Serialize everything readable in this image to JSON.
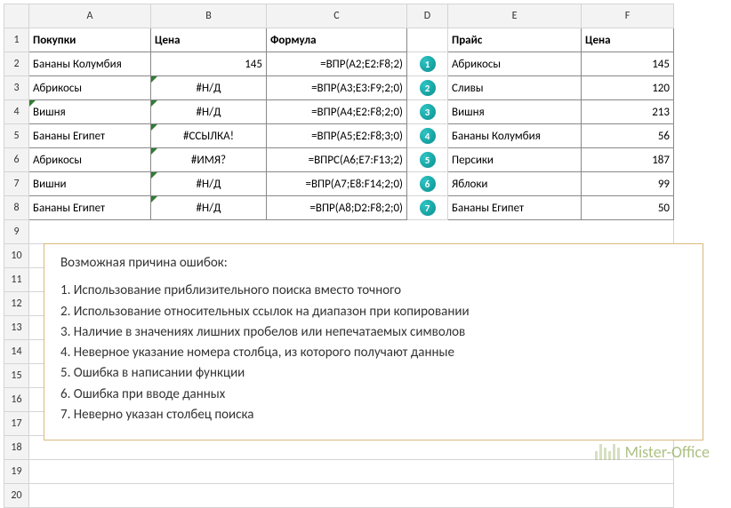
{
  "columns": [
    "A",
    "B",
    "C",
    "D",
    "E",
    "F"
  ],
  "rowNumbers": [
    1,
    2,
    3,
    4,
    5,
    6,
    7,
    8,
    9,
    10,
    11,
    12,
    13,
    14,
    15,
    16,
    17,
    18,
    19,
    20
  ],
  "header": {
    "A": "Покупки",
    "B": "Цена",
    "C": "Формула",
    "E": "Прайс",
    "F": "Цена"
  },
  "rows": [
    {
      "A": "Бананы Колумбия",
      "B": "145",
      "C": "=ВПР(A2;E2:F8;2)",
      "D": "1",
      "E": "Абрикосы",
      "F": "145"
    },
    {
      "A": "Абрикосы",
      "B": "#Н/Д",
      "C": "=ВПР(A3;E3:F9;2;0)",
      "D": "2",
      "E": "Сливы",
      "F": "120"
    },
    {
      "A": "Вишня",
      "B": "#Н/Д",
      "C": "=ВПР(A4;E2:F8;2;0)",
      "D": "3",
      "E": "Вишня",
      "F": "213"
    },
    {
      "A": "Бананы Египет",
      "B": "#ССЫЛКА!",
      "C": "=ВПР(A5;E2:F8;3;0)",
      "D": "4",
      "E": "Бананы Колумбия",
      "F": "56"
    },
    {
      "A": "Абрикосы",
      "B": "#ИМЯ?",
      "C": "=ВПРС(A6;E7:F13;2)",
      "D": "5",
      "E": "Персики",
      "F": "187"
    },
    {
      "A": "Вишни",
      "B": "#Н/Д",
      "C": "=ВПР(A7;E8:F14;2;0)",
      "D": "6",
      "E": "Яблоки",
      "F": "99"
    },
    {
      "A": "Бананы Египет",
      "B": "#Н/Д",
      "C": "=ВПР(A8;D2:F8;2;0)",
      "D": "7",
      "E": "Бананы Египет",
      "F": "50"
    }
  ],
  "textbox": {
    "title": "Возможная причина ошибок:",
    "items": [
      "1. Использование приблизительного поиска вместо точного",
      "2. Использование относительных ссылок на диапазон при копировании",
      "3. Наличие в значениях лишних пробелов или непечатаемых символов",
      "4. Неверное указание номера столбца, из которого получают данные",
      "5. Ошибка в написании функции",
      "6. Ошибка при вводе данных",
      "7. Неверно указан столбец поиска"
    ]
  },
  "logo": "Mister-Office"
}
